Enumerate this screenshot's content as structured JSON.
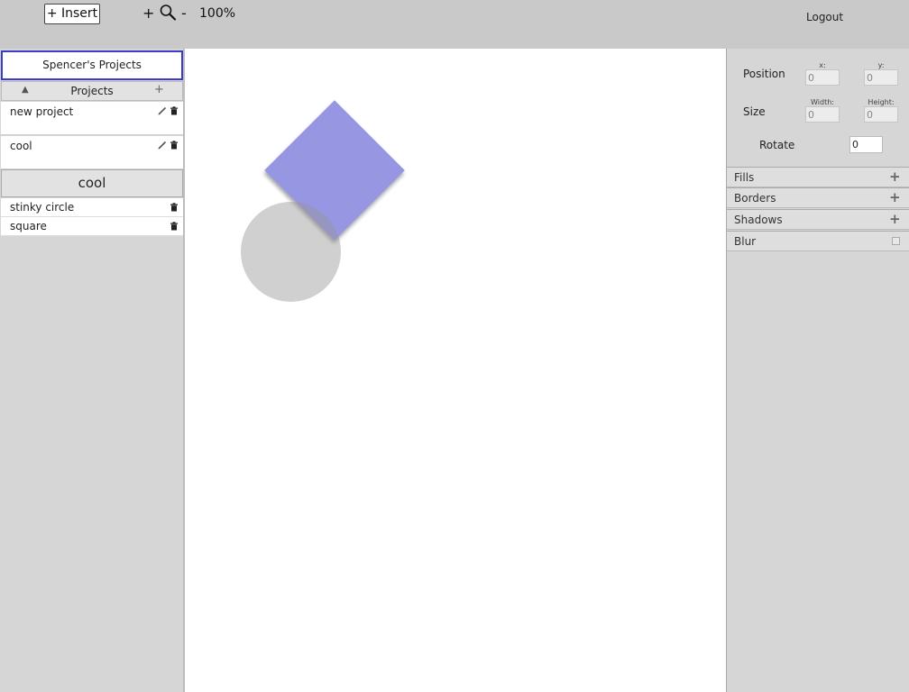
{
  "toolbar": {
    "insert_label": "+ Insert",
    "zoom_in": "+",
    "zoom_out": "-",
    "zoom_level": "100%",
    "logout": "Logout"
  },
  "sidebar": {
    "user_projects": "Spencer's Projects",
    "projects_header": "Projects",
    "collapse_icon": "▲",
    "add_icon": "+",
    "projects": [
      {
        "name": "new project"
      },
      {
        "name": "cool"
      }
    ],
    "current_project": "cool",
    "layers": [
      {
        "name": "stinky circle"
      },
      {
        "name": "square"
      }
    ]
  },
  "canvas": {
    "shapes": [
      {
        "type": "square",
        "color": "#8787de",
        "rotation_deg": 45
      },
      {
        "type": "circle",
        "color": "#969696"
      }
    ]
  },
  "properties": {
    "position_label": "Position",
    "x_label": "x:",
    "y_label": "y:",
    "x_value": "0",
    "y_value": "0",
    "size_label": "Size",
    "width_label": "Width:",
    "height_label": "Height:",
    "width_value": "0",
    "height_value": "0",
    "rotate_label": "Rotate",
    "rotate_value": "0",
    "sections": [
      {
        "label": "Fills",
        "icon": "+"
      },
      {
        "label": "Borders",
        "icon": "+"
      },
      {
        "label": "Shadows",
        "icon": "+"
      },
      {
        "label": "Blur"
      }
    ]
  },
  "colors": {
    "accent_border": "#3c3cc8",
    "square_fill": "#8787de"
  }
}
